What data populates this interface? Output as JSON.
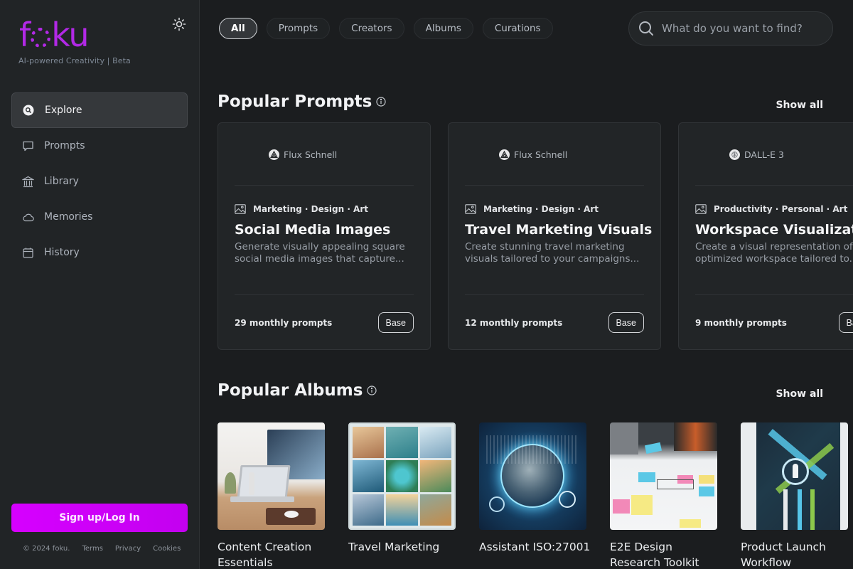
{
  "app": {
    "logo_prefix": "f",
    "logo_suffix": "ku",
    "tagline": "AI-powered Creativity | Beta",
    "brand_color": "#b229e6"
  },
  "sidebar": {
    "items": [
      {
        "label": "Explore",
        "icon": "search-circle-icon",
        "active": true
      },
      {
        "label": "Prompts",
        "icon": "chat-bubble-icon",
        "active": false
      },
      {
        "label": "Library",
        "icon": "library-icon",
        "active": false
      },
      {
        "label": "Memories",
        "icon": "cloud-icon",
        "active": false
      },
      {
        "label": "History",
        "icon": "calendar-icon",
        "active": false
      }
    ],
    "signup_label": "Sign up/Log In",
    "footer": {
      "copyright": "© 2024 foku.",
      "terms": "Terms",
      "privacy": "Privacy",
      "cookies": "Cookies"
    }
  },
  "header": {
    "chips": [
      {
        "label": "All",
        "active": true
      },
      {
        "label": "Prompts",
        "active": false
      },
      {
        "label": "Creators",
        "active": false
      },
      {
        "label": "Albums",
        "active": false
      },
      {
        "label": "Curations",
        "active": false
      }
    ],
    "search_placeholder": "What do you want to find?"
  },
  "popular_prompts": {
    "title": "Popular Prompts",
    "show_all": "Show all",
    "cards": [
      {
        "model": "Flux Schnell",
        "tags": "Marketing · Design · Art",
        "title": "Social Media Images",
        "description": "Generate visually appealing square social media images that capture...",
        "count": "29 monthly prompts",
        "badge": "Base"
      },
      {
        "model": "Flux Schnell",
        "tags": "Marketing · Design · Art",
        "title": "Travel Marketing Visuals",
        "description": "Create stunning travel marketing visuals tailored to your campaigns...",
        "count": "12 monthly prompts",
        "badge": "Base"
      },
      {
        "model": "DALL-E 3",
        "tags": "Productivity · Personal · Art",
        "title": "Workspace Visualization",
        "description": "Create a visual representation of optimized workspace tailored to...",
        "count": "9 monthly prompts",
        "badge": "Base"
      }
    ]
  },
  "popular_albums": {
    "title": "Popular Albums",
    "show_all": "Show all",
    "albums": [
      {
        "name": "Content Creation Essentials",
        "image": "desk-laptop-photo"
      },
      {
        "name": "Travel Marketing",
        "image": "travel-collage"
      },
      {
        "name": "Assistant ISO:27001",
        "image": "cybersecurity-globe"
      },
      {
        "name": "E2E Design Research Toolkit",
        "image": "sticky-notes-workshop"
      },
      {
        "name": "Product Launch Workflow",
        "image": "rocket-infographic"
      }
    ]
  }
}
